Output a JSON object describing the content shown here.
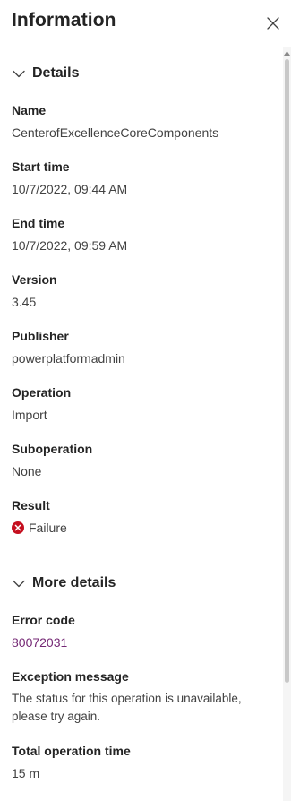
{
  "header": {
    "title": "Information",
    "close_icon": "close-icon"
  },
  "sections": {
    "details": {
      "label": "Details",
      "chevron_icon": "chevron-down-icon"
    },
    "more_details": {
      "label": "More details",
      "chevron_icon": "chevron-down-icon"
    }
  },
  "fields": {
    "name": {
      "label": "Name",
      "value": "CenterofExcellenceCoreComponents"
    },
    "start_time": {
      "label": "Start time",
      "value": "10/7/2022, 09:44 AM"
    },
    "end_time": {
      "label": "End time",
      "value": "10/7/2022, 09:59 AM"
    },
    "version": {
      "label": "Version",
      "value": "3.45"
    },
    "publisher": {
      "label": "Publisher",
      "value": "powerplatformadmin"
    },
    "operation": {
      "label": "Operation",
      "value": "Import"
    },
    "suboperation": {
      "label": "Suboperation",
      "value": "None"
    },
    "result": {
      "label": "Result",
      "value": "Failure",
      "status_icon": "error-circle-icon",
      "status_color": "#c50f1f"
    },
    "error_code": {
      "label": "Error code",
      "value": "80072031",
      "link_color": "#742774"
    },
    "exception_message": {
      "label": "Exception message",
      "value": "The status for this operation is unavailable, please try again."
    },
    "total_operation_time": {
      "label": "Total operation time",
      "value": "15 m"
    }
  }
}
